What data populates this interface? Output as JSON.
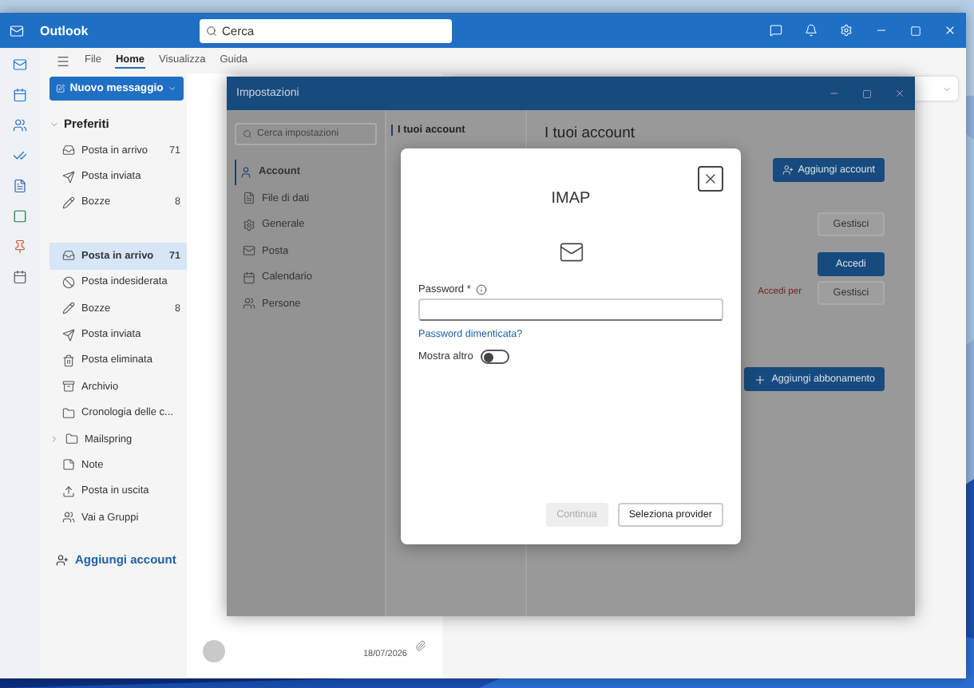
{
  "app": {
    "title": "Outlook",
    "search_placeholder": "Cerca"
  },
  "ribbon_tabs": [
    {
      "label": "File",
      "selected": false
    },
    {
      "label": "Home",
      "selected": true
    },
    {
      "label": "Visualizza",
      "selected": false
    },
    {
      "label": "Guida",
      "selected": false
    }
  ],
  "new_message": "Nuovo messaggio",
  "folders": {
    "favorites_label": "Preferiti",
    "favorites": [
      {
        "name": "Posta in arrivo",
        "count": "71",
        "selected": false,
        "kind": "folder"
      },
      {
        "name": "Posta inviata",
        "selected": false,
        "kind": "folder"
      },
      {
        "name": "Bozze",
        "count": "8",
        "selected": false,
        "kind": "folder"
      }
    ],
    "account_folders": [
      {
        "name": "Posta in arrivo",
        "count": "71",
        "selected": true,
        "kind": "folder"
      },
      {
        "name": "Posta indesiderata",
        "selected": false,
        "kind": "folder"
      },
      {
        "name": "Bozze",
        "count": "8",
        "selected": false,
        "kind": "folder"
      },
      {
        "name": "Posta inviata",
        "selected": false,
        "kind": "folder"
      },
      {
        "name": "Posta eliminata",
        "selected": false,
        "kind": "folder"
      },
      {
        "name": "Archivio",
        "selected": false,
        "kind": "folder"
      },
      {
        "name": "Cronologia delle c...",
        "selected": false,
        "kind": "folder"
      },
      {
        "name": "Mailspring",
        "selected": false,
        "kind": "parent"
      },
      {
        "name": "Note",
        "selected": false,
        "kind": "folder"
      },
      {
        "name": "Posta in uscita",
        "selected": false,
        "kind": "folder"
      },
      {
        "name": "Vai a Gruppi",
        "selected": false,
        "kind": "folder"
      }
    ],
    "add_account": "Aggiungi account"
  },
  "message_preview": {
    "date": "18/07/2026"
  },
  "settings": {
    "title": "Impostazioni",
    "search_placeholder": "Cerca impostazioni",
    "nav": [
      {
        "label": "Account",
        "selected": true
      },
      {
        "label": "File di dati",
        "selected": false
      },
      {
        "label": "Generale",
        "selected": false
      },
      {
        "label": "Posta",
        "selected": false
      },
      {
        "label": "Calendario",
        "selected": false
      },
      {
        "label": "Persone",
        "selected": false
      }
    ],
    "subnav": [
      {
        "label": "I tuoi account",
        "selected": true
      }
    ],
    "heading": "I tuoi account",
    "add_account_button": "Aggiungi account",
    "accounts": [
      {
        "buttons": [
          {
            "label": "Gestisci",
            "primary": false
          }
        ]
      },
      {
        "note": "Accedi per",
        "buttons": [
          {
            "label": "Accedi",
            "primary": true
          },
          {
            "label": "Gestisci",
            "primary": false
          }
        ]
      }
    ],
    "add_subscription_button": "Aggiungi abbonamento"
  },
  "modal": {
    "title": "IMAP",
    "password_label": "Password",
    "required_mark": "*",
    "forgot_link": "Password dimenticata?",
    "toggle": {
      "label": "Mostra altro",
      "on": false
    },
    "buttons": [
      {
        "label": "Continua",
        "disabled": true
      },
      {
        "label": "Seleziona provider",
        "disabled": false
      }
    ]
  }
}
